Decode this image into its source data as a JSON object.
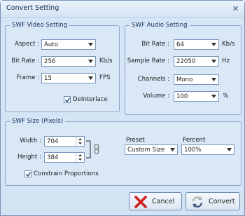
{
  "window": {
    "title": "Convert Setting"
  },
  "video": {
    "title": "SWF Video Setting",
    "aspect_label": "Aspect :",
    "aspect_value": "Auto",
    "bitrate_label": "Bit Rate :",
    "bitrate_value": "256",
    "bitrate_unit": "Kb/s",
    "frame_label": "Frame :",
    "frame_value": "15",
    "frame_unit": "FPS",
    "deinterlace_label": "DeInterlace",
    "deinterlace_checked": true
  },
  "audio": {
    "title": "SWF Audio Setting",
    "bitrate_label": "Bit Rate :",
    "bitrate_value": "64",
    "bitrate_unit": "Kb/s",
    "samplerate_label": "Sample Rate :",
    "samplerate_value": "22050",
    "samplerate_unit": "Hz",
    "channels_label": "Channels :",
    "channels_value": "Mono",
    "volume_label": "Volume :",
    "volume_value": "100",
    "volume_unit": "%"
  },
  "size": {
    "title": "SWF Size (Pixels)",
    "width_label": "Width :",
    "width_value": "704",
    "height_label": "Height :",
    "height_value": "384",
    "preset_label": "Preset",
    "preset_value": "Custom Size",
    "percent_label": "Percent",
    "percent_value": "100%",
    "constrain_label": "Constrain Proportions",
    "constrain_checked": true
  },
  "buttons": {
    "cancel": "Cancel",
    "convert": "Convert"
  },
  "icons": {
    "close": "close-icon",
    "link": "chain-link-icon",
    "cancel": "red-x-icon",
    "convert": "convert-arrows-icon"
  }
}
